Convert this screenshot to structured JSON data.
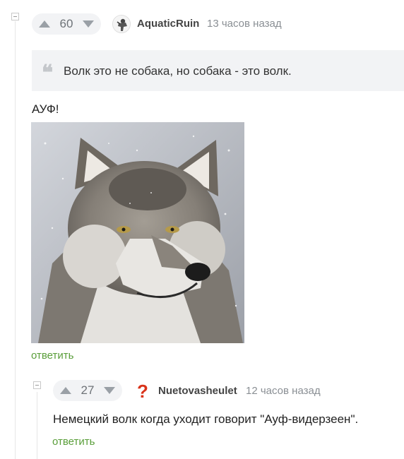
{
  "comment": {
    "rating": "60",
    "author": "AquaticRuin",
    "time": "13 часов назад",
    "quote": "Волк это не собака, но собака - это волк.",
    "text": "АУФ!",
    "reply": "ответить"
  },
  "reply_comment": {
    "rating": "27",
    "author": "Nuetovasheulet",
    "time": "12 часов назад",
    "text": "Немецкий волк когда уходит говорит \"Ауф-видерзеен\".",
    "reply": "ответить"
  },
  "icons": {
    "quote": "quote-icon",
    "upvote": "arrow-up-icon",
    "downvote": "arrow-down-icon",
    "collapse": "collapse-minus-icon",
    "avatar_question": "question-mark-icon"
  },
  "colors": {
    "link": "#5a9e3a",
    "author": "#444444",
    "muted": "#8a8f94",
    "panel": "#f2f3f5",
    "avatar_question": "#d9331a"
  }
}
